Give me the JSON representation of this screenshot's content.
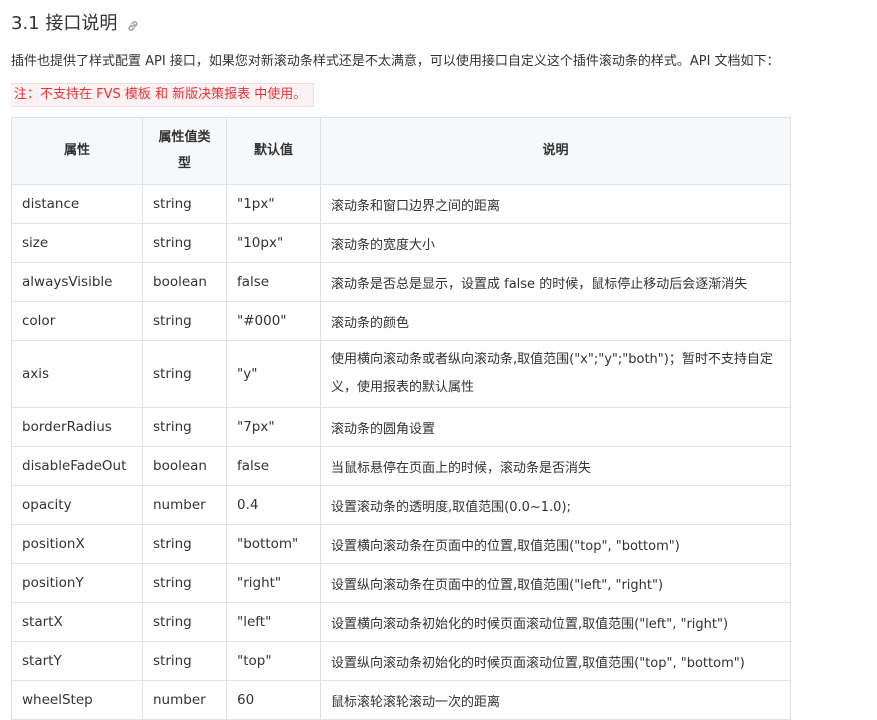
{
  "section": {
    "title": "3.1 接口说明",
    "link_icon": "link-icon"
  },
  "intro": "插件也提供了样式配置 API 接口，如果您对新滚动条样式还是不太满意，可以使用接口自定义这个插件滚动条的样式。API 文档如下：",
  "note": "注：不支持在 FVS 模板 和 新版决策报表 中使用。",
  "colors": {
    "note_text": "#e3343a",
    "note_bg": "#fdf2f3",
    "header_bg": "#f7f8fa",
    "border": "#dfe2e5"
  },
  "table": {
    "headers": [
      "属性",
      "属性值类型",
      "默认值",
      "说明"
    ],
    "rows": [
      {
        "attr": "distance",
        "type": "string",
        "default": "\"1px\"",
        "desc": "滚动条和窗口边界之间的距离"
      },
      {
        "attr": "size",
        "type": "string",
        "default": "\"10px\"",
        "desc": "滚动条的宽度大小"
      },
      {
        "attr": "alwaysVisible",
        "type": "boolean",
        "default": "false",
        "desc": "滚动条是否总是显示，设置成 false 的时候，鼠标停止移动后会逐渐消失"
      },
      {
        "attr": "color",
        "type": "string",
        "default": "\"#000\"",
        "desc": "滚动条的颜色"
      },
      {
        "attr": "axis",
        "type": "string",
        "default": "\"y\"",
        "desc": "使用横向滚动条或者纵向滚动条,取值范围(\"x\";\"y\";\"both\")；暂时不支持自定义，使用报表的默认属性"
      },
      {
        "attr": "borderRadius",
        "type": "string",
        "default": "\"7px\"",
        "desc": "滚动条的圆角设置"
      },
      {
        "attr": "disableFadeOut",
        "type": "boolean",
        "default": "false",
        "desc": "当鼠标悬停在页面上的时候，滚动条是否消失"
      },
      {
        "attr": "opacity",
        "type": "number",
        "default": "0.4",
        "desc": "设置滚动条的透明度,取值范围(0.0~1.0);"
      },
      {
        "attr": "positionX",
        "type": "string",
        "default": "\"bottom\"",
        "desc": "设置横向滚动条在页面中的位置,取值范围(\"top\", \"bottom\")"
      },
      {
        "attr": "positionY",
        "type": "string",
        "default": "\"right\"",
        "desc": "设置纵向滚动条在页面中的位置,取值范围(\"left\", \"right\")"
      },
      {
        "attr": "startX",
        "type": "string",
        "default": "\"left\"",
        "desc": "设置横向滚动条初始化的时候页面滚动位置,取值范围(\"left\", \"right\")"
      },
      {
        "attr": "startY",
        "type": "string",
        "default": "\"top\"",
        "desc": "设置纵向滚动条初始化的时候页面滚动位置,取值范围(\"top\", \"bottom\")"
      },
      {
        "attr": "wheelStep",
        "type": "number",
        "default": "60",
        "desc": "鼠标滚轮滚轮滚动一次的距离"
      }
    ]
  }
}
